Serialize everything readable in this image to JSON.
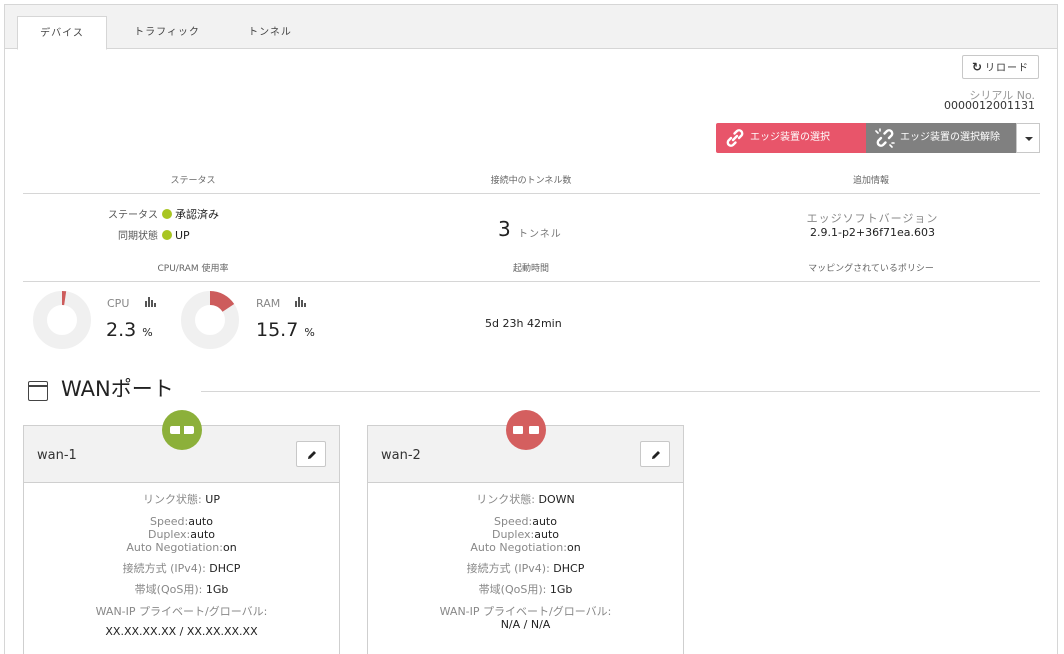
{
  "tabs": [
    {
      "label": "デバイス",
      "active": true
    },
    {
      "label": "トラフィック",
      "active": false
    },
    {
      "label": "トンネル",
      "active": false
    }
  ],
  "toolbar": {
    "reload_label": "リロード",
    "serial_label": "シリアル No.",
    "serial_value": "0000012001131",
    "select_edge_label": "エッジ装置の選択",
    "deselect_edge_label": "エッジ装置の選択解除"
  },
  "colors": {
    "select": "#e8556a",
    "deselect": "#808080",
    "status_ok": "#a8c522",
    "port_up": "#8cb03a",
    "port_down": "#d45f5f",
    "donut_fill": "#cd5c5c"
  },
  "sections": {
    "status": "ステータス",
    "tunnels": "接続中のトンネル数",
    "extra": "追加情報",
    "cpu_ram": "CPU/RAM 使用率",
    "uptime": "起動時間",
    "policy": "マッピングされているポリシー"
  },
  "status": {
    "status_key": "ステータス",
    "status_value": "承認済み",
    "sync_key": "同期状態",
    "sync_value": "UP"
  },
  "tunnels": {
    "count": "3",
    "unit": "トンネル"
  },
  "extra": {
    "label": "エッジソフトバージョン",
    "value": "2.9.1-p2+36f71ea.603"
  },
  "resources": {
    "cpu": {
      "label": "CPU",
      "value": "2.3",
      "unit": "%",
      "percent": 2.3
    },
    "ram": {
      "label": "RAM",
      "value": "15.7",
      "unit": "%",
      "percent": 15.7
    }
  },
  "uptime": "5d 23h 42min",
  "wan_section_title": "WANポート",
  "wan_ports": [
    {
      "name": "wan-1",
      "state": "up",
      "link_key": "リンク状態:",
      "link_value": "UP",
      "speed_key": "Speed:",
      "speed_value": "auto",
      "duplex_key": "Duplex:",
      "duplex_value": "auto",
      "autoneg_key": "Auto Negotiation:",
      "autoneg_value": "on",
      "conn_key": "接続方式 (IPv4):",
      "conn_value": "DHCP",
      "bw_key": "帯域(QoS用):",
      "bw_value": "1Gb",
      "ip_key": "WAN-IP プライベート/グローバル:",
      "ip_value": "XX.XX.XX.XX / XX.XX.XX.XX"
    },
    {
      "name": "wan-2",
      "state": "down",
      "link_key": "リンク状態:",
      "link_value": "DOWN",
      "speed_key": "Speed:",
      "speed_value": "auto",
      "duplex_key": "Duplex:",
      "duplex_value": "auto",
      "autoneg_key": "Auto Negotiation:",
      "autoneg_value": "on",
      "conn_key": "接続方式 (IPv4):",
      "conn_value": "DHCP",
      "bw_key": "帯域(QoS用):",
      "bw_value": "1Gb",
      "ip_key": "WAN-IP プライベート/グローバル:",
      "ip_value": "N/A / N/A"
    }
  ]
}
